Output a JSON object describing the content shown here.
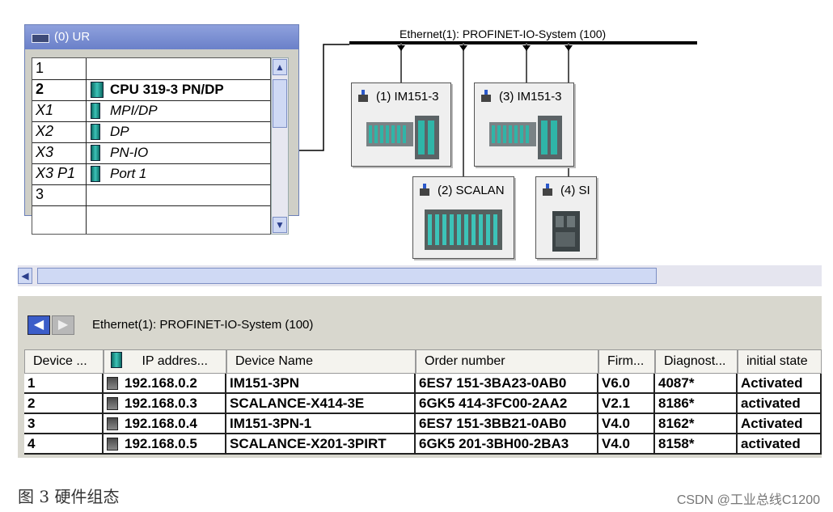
{
  "rack": {
    "title": "(0) UR",
    "rows": [
      {
        "slot": "1",
        "module": ""
      },
      {
        "slot": "2",
        "module": "CPU 319-3 PN/DP"
      },
      {
        "slot": "X1",
        "module": "MPI/DP"
      },
      {
        "slot": "X2",
        "module": "DP"
      },
      {
        "slot": "X3",
        "module": "PN-IO"
      },
      {
        "slot": "X3 P1",
        "module": "Port 1"
      },
      {
        "slot": "3",
        "module": ""
      }
    ]
  },
  "network": {
    "ethernet_label": "Ethernet(1): PROFINET-IO-System (100)",
    "devices": [
      {
        "label": "(1) IM151-3"
      },
      {
        "label": "(3) IM151-3"
      },
      {
        "label": "(2) SCALAN"
      },
      {
        "label": "(4) SI"
      }
    ]
  },
  "bottom": {
    "title": "Ethernet(1): PROFINET-IO-System (100)",
    "columns": [
      "Device ...",
      "IP addres...",
      "Device Name",
      "Order number",
      "Firm...",
      "Diagnost...",
      "initial state"
    ],
    "rows": [
      {
        "num": "1",
        "ip": "192.168.0.2",
        "name": "IM151-3PN",
        "order": "6ES7 151-3BA23-0AB0",
        "firm": "V6.0",
        "diag": "4087*",
        "state": "Activated"
      },
      {
        "num": "2",
        "ip": "192.168.0.3",
        "name": "SCALANCE-X414-3E",
        "order": "6GK5 414-3FC00-2AA2",
        "firm": "V2.1",
        "diag": "8186*",
        "state": "activated"
      },
      {
        "num": "3",
        "ip": "192.168.0.4",
        "name": "IM151-3PN-1",
        "order": "6ES7 151-3BB21-0AB0",
        "firm": "V4.0",
        "diag": "8162*",
        "state": "Activated"
      },
      {
        "num": "4",
        "ip": "192.168.0.5",
        "name": "SCALANCE-X201-3PIRT",
        "order": "6GK5 201-3BH00-2BA3",
        "firm": "V4.0",
        "diag": "8158*",
        "state": "activated"
      }
    ]
  },
  "caption": "图 3 硬件组态",
  "watermark": "CSDN @工业总线C1200",
  "colors": {
    "accent": "#6a80c9",
    "module_teal": "#3cc3b8"
  }
}
